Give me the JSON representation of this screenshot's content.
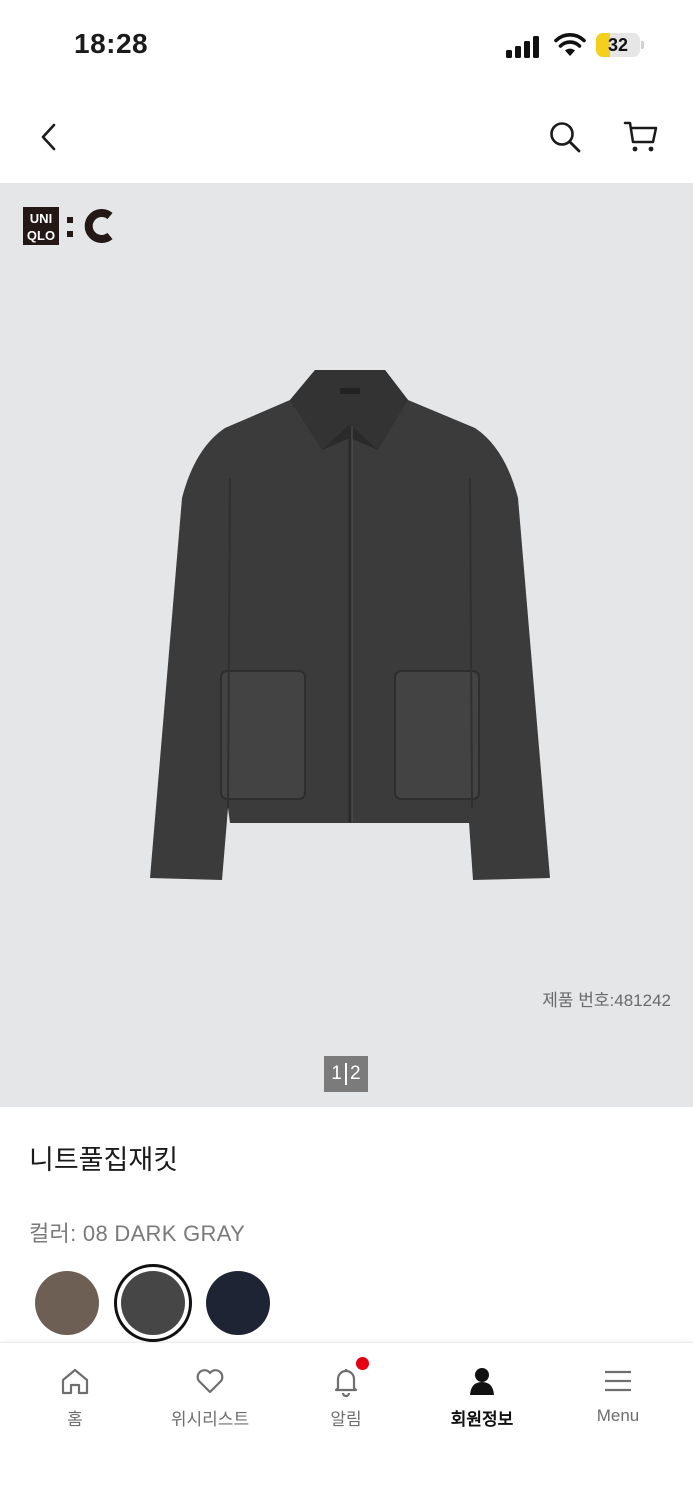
{
  "status": {
    "time": "18:28",
    "battery": "32",
    "battery_level": 0.32
  },
  "brand": {
    "logo_lines": [
      "UNI",
      "QLO"
    ],
    "logo_suffix": ":C"
  },
  "gallery": {
    "product_number": "제품 번호:481242",
    "page_current": "1",
    "page_total": "2"
  },
  "product": {
    "name": "니트풀집재킷",
    "color_label": "컬러: 08 DARK GRAY",
    "swatches": [
      {
        "name": "brown",
        "color": "#6e5f55",
        "selected": false
      },
      {
        "name": "dark-gray",
        "color": "#464646",
        "selected": true
      },
      {
        "name": "navy",
        "color": "#1f2434",
        "selected": false
      }
    ]
  },
  "tabs": [
    {
      "label": "홈",
      "icon": "home-icon"
    },
    {
      "label": "위시리스트",
      "icon": "heart-icon"
    },
    {
      "label": "알림",
      "icon": "bell-icon"
    },
    {
      "label": "회원정보",
      "icon": "person-icon"
    },
    {
      "label": "Menu",
      "icon": "menu-icon"
    }
  ],
  "colors": {
    "gallery_bg": "#e5e6e8",
    "badge": "#e60012",
    "battery": "#f4cf1c"
  }
}
